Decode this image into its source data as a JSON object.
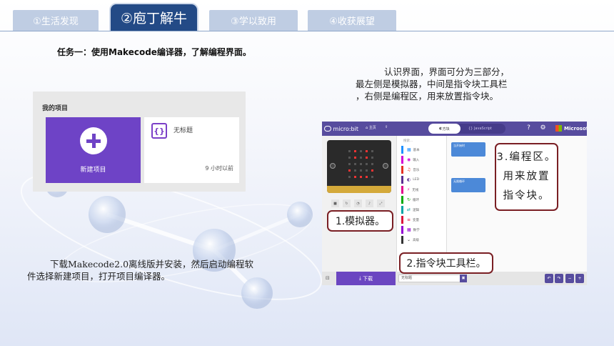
{
  "tabs": [
    {
      "label": "①生活发现",
      "active": false
    },
    {
      "label": "②庖丁解牛",
      "active": true
    },
    {
      "label": "③学以致用",
      "active": false
    },
    {
      "label": "④收获展望",
      "active": false
    }
  ],
  "task_title": "任务一：使用Makecode编译器，了解编程界面。",
  "description_right": {
    "line1": "认识界面，界面可分为三部分，",
    "line2": "最左侧是模拟器，中间是指令块工具栏",
    "line3": "，右侧是编程区，用来放置指令块。"
  },
  "description_left": {
    "line1": "下载Makecode2.0离线版并安装，然后启动编程软",
    "line2": "件选择新建项目，打开项目编译器。"
  },
  "projects_panel": {
    "header": "我的项目",
    "new_project_label": "新建项目",
    "project_name": "无标题",
    "project_time": "9 小时以前"
  },
  "editor": {
    "logo": "micro:bit",
    "home_label": "主页",
    "share_label": "",
    "blocks_tab": "方块",
    "js_tab": "JavaScript",
    "brand": "Microsoft",
    "search_placeholder": "搜索...",
    "toolbox": [
      {
        "label": "基本",
        "color": "#1e90ff",
        "glyph": "▦"
      },
      {
        "label": "输入",
        "color": "#d400d4",
        "glyph": "◉"
      },
      {
        "label": "音乐",
        "color": "#e63022",
        "glyph": "♫"
      },
      {
        "label": "LED",
        "color": "#5c2d91",
        "glyph": "◐"
      },
      {
        "label": "无线",
        "color": "#e3008c",
        "glyph": "⚡"
      },
      {
        "label": "循环",
        "color": "#00aa00",
        "glyph": "↻"
      },
      {
        "label": "逻辑",
        "color": "#00a4a6",
        "glyph": "⇄"
      },
      {
        "label": "变量",
        "color": "#dc143c",
        "glyph": "≡"
      },
      {
        "label": "数学",
        "color": "#9400d3",
        "glyph": "▦"
      },
      {
        "label": "高级",
        "color": "#333333",
        "glyph": "⌄"
      }
    ],
    "block_start": "当开始时",
    "block_forever": "无限循环",
    "download_label": "下载",
    "filename": "无标题",
    "colors": {
      "header": "#574c9e",
      "download": "#6b46c1",
      "block": "#4c89d8"
    }
  },
  "callouts": {
    "simulator": "1.模拟器。",
    "toolbox": "2.指令块工具栏。",
    "workspace_l1": "3.编程区。",
    "workspace_l2": "用来放置",
    "workspace_l3": "指令块。"
  }
}
